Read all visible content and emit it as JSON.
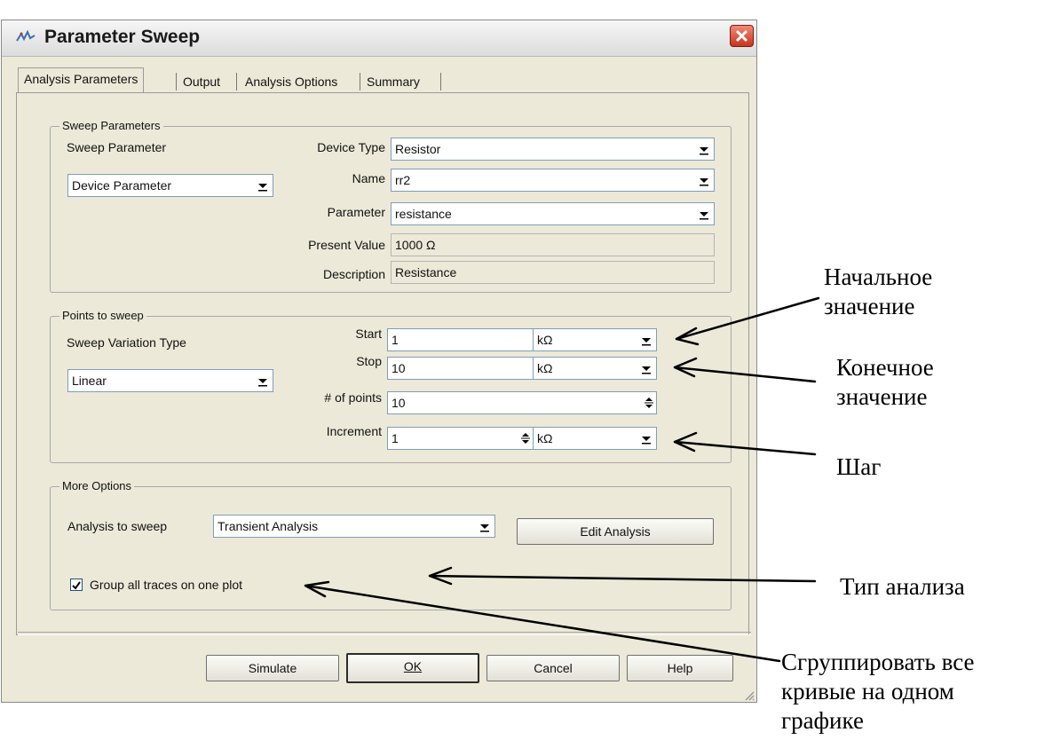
{
  "window": {
    "title": "Parameter Sweep"
  },
  "tabs": [
    "Analysis Parameters",
    "Output",
    "Analysis Options",
    "Summary"
  ],
  "sweep_parameters": {
    "group_title": "Sweep Parameters",
    "sweep_parameter_label": "Sweep Parameter",
    "sweep_parameter_value": "Device Parameter",
    "device_type_label": "Device Type",
    "device_type_value": "Resistor",
    "name_label": "Name",
    "name_value": "rr2",
    "parameter_label": "Parameter",
    "parameter_value": "resistance",
    "present_value_label": "Present Value",
    "present_value": "1000 Ω",
    "description_label": "Description",
    "description_value": "Resistance"
  },
  "points_to_sweep": {
    "group_title": "Points to sweep",
    "variation_type_label": "Sweep Variation Type",
    "variation_type_value": "Linear",
    "start_label": "Start",
    "start_value": "1",
    "start_unit": "kΩ",
    "stop_label": "Stop",
    "stop_value": "10",
    "stop_unit": "kΩ",
    "points_label": "# of points",
    "points_value": "10",
    "increment_label": "Increment",
    "increment_value": "1",
    "increment_unit": "kΩ"
  },
  "more_options": {
    "group_title": "More Options",
    "analysis_label": "Analysis to sweep",
    "analysis_value": "Transient Analysis",
    "edit_button": "Edit Analysis",
    "group_traces_label": "Group all traces on one plot",
    "group_traces_checked": true
  },
  "footer": {
    "simulate": "Simulate",
    "ok": "OK",
    "cancel": "Cancel",
    "help": "Help"
  },
  "annotations": {
    "start": [
      "Начальное",
      "значение"
    ],
    "stop": [
      "Конечное",
      "значение"
    ],
    "step": "Шаг",
    "analysis_type": "Тип анализа",
    "group_traces": [
      "Сгруппировать все",
      "кривые на одном",
      "графике"
    ]
  },
  "colors": {
    "close_button": "#c7331b",
    "field_border": "#7f9db9",
    "dialog_bg": "#ece9d8"
  }
}
